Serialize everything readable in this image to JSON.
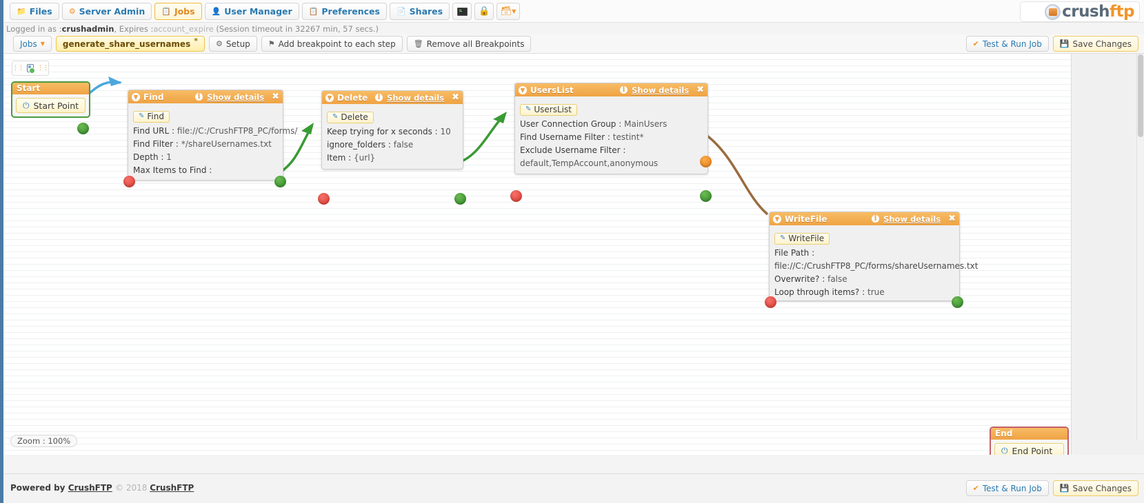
{
  "nav": {
    "tabs": [
      {
        "label": "Files",
        "icon": "folder-icon",
        "active": false
      },
      {
        "label": "Server Admin",
        "icon": "gear-icon",
        "active": false
      },
      {
        "label": "Jobs",
        "icon": "clipboard-icon",
        "active": true
      },
      {
        "label": "User Manager",
        "icon": "user-icon",
        "active": false
      },
      {
        "label": "Preferences",
        "icon": "sliders-icon",
        "active": false
      },
      {
        "label": "Shares",
        "icon": "share-icon",
        "active": false
      }
    ],
    "icon_buttons": [
      "terminal-icon",
      "plug-icon",
      "screen-dropdown-icon"
    ]
  },
  "logo": {
    "part1": "crush",
    "part2": "ftp"
  },
  "session": {
    "prefix": "Logged in as : ",
    "user": "crushadmin",
    "expires_label": ", Expires : ",
    "expires_value": "account_expire",
    "timeout": "(Session timeout in 32267 min, 57 secs.)"
  },
  "jobbar": {
    "jobs_menu": "Jobs",
    "job_name": "generate_share_usernames",
    "job_modified_marker": "*",
    "setup": "Setup",
    "add_breakpoint": "Add breakpoint to each step",
    "remove_breakpoints": "Remove all Breakpoints",
    "test_run": "Test & Run Job",
    "save_changes": "Save Changes"
  },
  "canvas": {
    "zoom_label": "Zoom : 100%",
    "show_details": "Show details",
    "close_glyph": "✖"
  },
  "nodes": {
    "start": {
      "title": "Start",
      "button": "Start Point"
    },
    "find": {
      "title": "Find",
      "type_tag": "Find",
      "props": [
        {
          "key": "Find URL :",
          "value": "file://C:/CrushFTP8_PC/forms/"
        },
        {
          "key": "Find Filter :",
          "value": "*/shareUsernames.txt"
        },
        {
          "key": "Depth :",
          "value": "1"
        },
        {
          "key": "Max Items to Find :",
          "value": ""
        }
      ]
    },
    "delete": {
      "title": "Delete",
      "type_tag": "Delete",
      "props": [
        {
          "key": "Keep trying for x seconds :",
          "value": "10"
        },
        {
          "key": "ignore_folders :",
          "value": "false"
        },
        {
          "key": "Item :",
          "value": "{url}"
        }
      ]
    },
    "userslist": {
      "title": "UsersList",
      "type_tag": "UsersList",
      "props": [
        {
          "key": "User Connection Group :",
          "value": "MainUsers"
        },
        {
          "key": "Find Username Filter :",
          "value": "testint*"
        },
        {
          "key": "Exclude Username Filter :",
          "value": ""
        },
        {
          "key": "default,TempAccount,anonymous",
          "value": ""
        }
      ]
    },
    "writefile": {
      "title": "WriteFile",
      "type_tag": "WriteFile",
      "props": [
        {
          "key": "File Path :",
          "value": ""
        },
        {
          "key": "file://C:/CrushFTP8_PC/forms/shareUsernames.txt",
          "value": ""
        },
        {
          "key": "Overwrite? :",
          "value": "false"
        },
        {
          "key": "Loop through items? :",
          "value": "true"
        }
      ]
    },
    "end": {
      "title": "End",
      "button": "End Point"
    }
  },
  "footer": {
    "powered_prefix": "Powered by ",
    "powered_link": "CrushFTP",
    "copyright": "© 2018 ",
    "copyright_link": "CrushFTP",
    "test_run": "Test & Run Job",
    "save_changes": "Save Changes"
  },
  "colors": {
    "accent_orange": "#f0952a",
    "link_blue": "#2a7ab0",
    "node_header": "#efa344",
    "port_red": "#e23b30",
    "port_green": "#2f8a2a",
    "port_orange": "#ef8412",
    "wire_blue": "#4aa8dd",
    "wire_green": "#3a9a34",
    "wire_brown": "#9a6b3f"
  }
}
